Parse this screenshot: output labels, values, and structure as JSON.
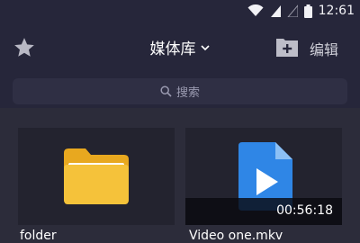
{
  "status_bar": {
    "time": "12:61"
  },
  "header": {
    "title": "媒体库",
    "edit_label": "编辑"
  },
  "search": {
    "placeholder": "搜索"
  },
  "items": [
    {
      "name": "folder",
      "type": "folder"
    },
    {
      "name": "Video one.mkv",
      "type": "video",
      "duration": "00:56:18"
    }
  ],
  "colors": {
    "background": "#2c2c3a",
    "folder": "#f5c23a",
    "video": "#2f86e6"
  }
}
